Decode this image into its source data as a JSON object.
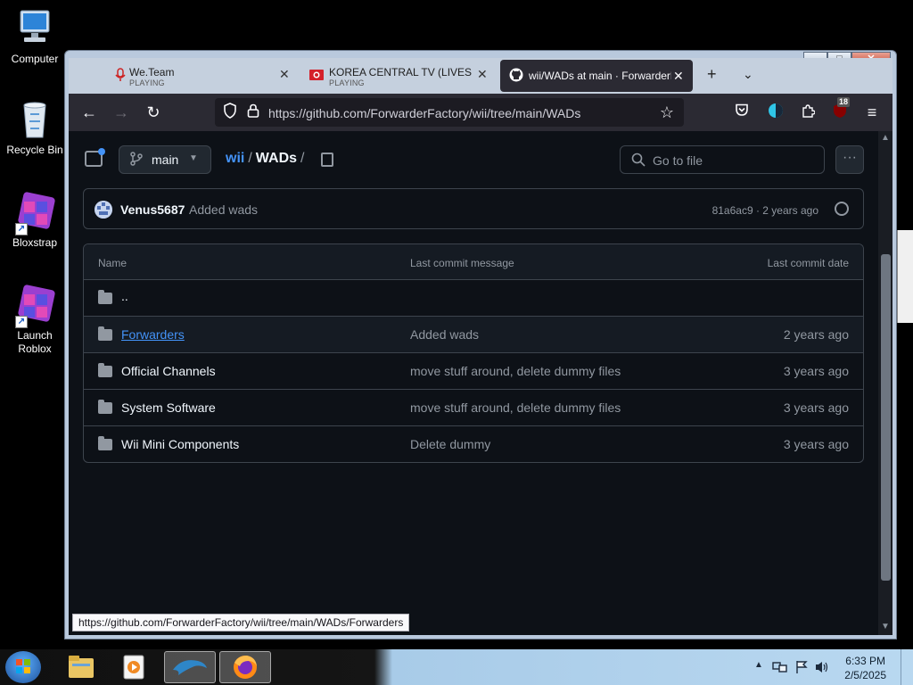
{
  "desktop": {
    "icons": [
      {
        "label": "Computer"
      },
      {
        "label": "Recycle Bin"
      },
      {
        "label": "Bloxstrap"
      },
      {
        "label": "Launch Roblox"
      }
    ]
  },
  "browser": {
    "tabs": [
      {
        "title": "We.Team",
        "subtitle": "PLAYING",
        "active": false
      },
      {
        "title": "KOREA CENTRAL TV (LIVESTRE",
        "subtitle": "PLAYING",
        "active": false
      },
      {
        "title": "wii/WADs at main · ForwarderF",
        "subtitle": "",
        "active": true
      }
    ],
    "url": "https://github.com/ForwarderFactory/wii/tree/main/WADs",
    "notification_count": "18",
    "status_url": "https://github.com/ForwarderFactory/wii/tree/main/WADs/Forwarders"
  },
  "repo": {
    "branch": "main",
    "breadcrumb": {
      "repo": "wii",
      "sep": "/",
      "folder": "WADs",
      "trail": "/"
    },
    "search_placeholder": "Go to file",
    "more_label": "···",
    "latest_commit": {
      "author": "Venus5687",
      "message": "Added wads",
      "meta": "81a6ac9 · 2 years ago"
    },
    "table_headers": {
      "name": "Name",
      "message": "Last commit message",
      "date": "Last commit date"
    },
    "rows": [
      {
        "name": "..",
        "message": "",
        "date": ""
      },
      {
        "name": "Forwarders",
        "message": "Added wads",
        "date": "2 years ago"
      },
      {
        "name": "Official Channels",
        "message": "move stuff around, delete dummy files",
        "date": "3 years ago"
      },
      {
        "name": "System Software",
        "message": "move stuff around, delete dummy files",
        "date": "3 years ago"
      },
      {
        "name": "Wii Mini Components",
        "message": "Delete dummy",
        "date": "3 years ago"
      }
    ]
  },
  "taskbar": {
    "time": "6:33 PM",
    "date": "2/5/2025"
  },
  "colors": {
    "github_bg": "#0d1117",
    "link": "#4493f8",
    "firefox_toolbar": "#2b2a33"
  }
}
